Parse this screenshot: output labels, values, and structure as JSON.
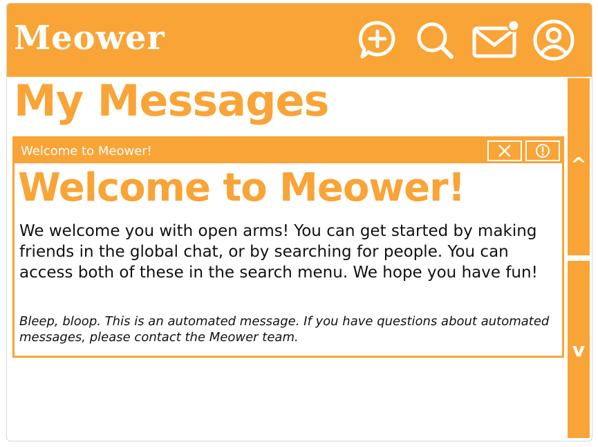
{
  "app": {
    "logo": "Meower"
  },
  "header": {
    "icons": [
      "new-post-icon",
      "search-icon",
      "mail-icon",
      "profile-icon"
    ],
    "accent": "#f9a436"
  },
  "page": {
    "title": "My Messages"
  },
  "message": {
    "bar_title": "Welcome to Meower!",
    "heading": "Welcome to Meower!",
    "body": "We welcome you with open arms! You can get started by making friends in the global chat, or by searching for people. You can access both of these in the search menu. We hope you have fun!",
    "note": "Bleep, bloop. This is an automated message. If you have questions about automated messages, please contact the Meower team.",
    "close_icon": "close-icon",
    "report_icon": "alert-icon"
  },
  "scrollbar": {
    "up_label": "^",
    "down_label": "v"
  }
}
